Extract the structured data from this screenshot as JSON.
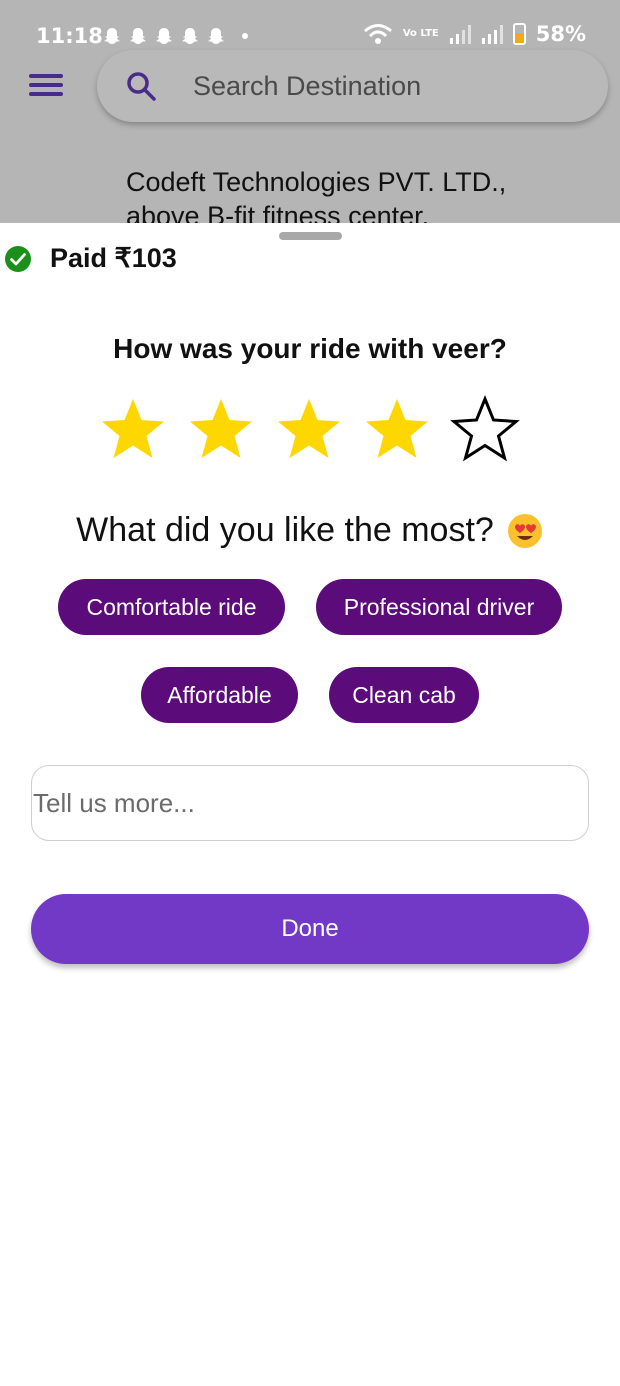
{
  "status_bar": {
    "time": "11:18",
    "network_label": "Vo LTE",
    "battery": "58%",
    "battery_level": 0.58
  },
  "header": {
    "search_placeholder": "Search Destination",
    "address_line1": "Codeft Technologies PVT. LTD.,",
    "address_line2": "above B-fit fitness center,"
  },
  "sheet": {
    "paid_text": "Paid ₹103",
    "rating_question": "How was your ride with veer?",
    "rating": {
      "value": 4,
      "max": 5
    },
    "like_question": "What did you like the most?",
    "chips": [
      "Comfortable ride",
      "Professional driver",
      "Affordable",
      "Clean cab"
    ],
    "feedback_placeholder": "Tell us more...",
    "done_label": "Done"
  },
  "colors": {
    "chip_bg": "#5c0b7a",
    "primary_button": "#7239c7",
    "star_filled": "#ffd700",
    "paid_check": "#1a8f1a",
    "backdrop": "#b5b5b5"
  }
}
